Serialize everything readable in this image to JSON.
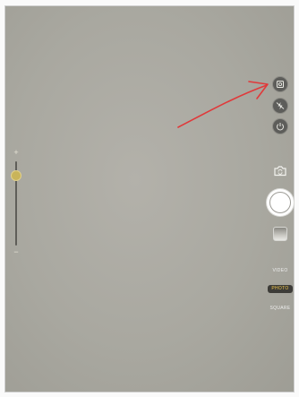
{
  "camera": {
    "zoom": {
      "plus_label": "+",
      "minus_label": "−",
      "level": 0.17
    },
    "controls": [
      {
        "name": "hdr-icon"
      },
      {
        "name": "flash-off-icon"
      },
      {
        "name": "timer-icon"
      }
    ],
    "modes": {
      "video_label": "VIDEO",
      "photo_label": "PHOTO",
      "square_label": "SQUARE",
      "selected": "PHOTO"
    }
  },
  "colors": {
    "accent": "#f1c84d",
    "annotation": "#e0393a"
  }
}
